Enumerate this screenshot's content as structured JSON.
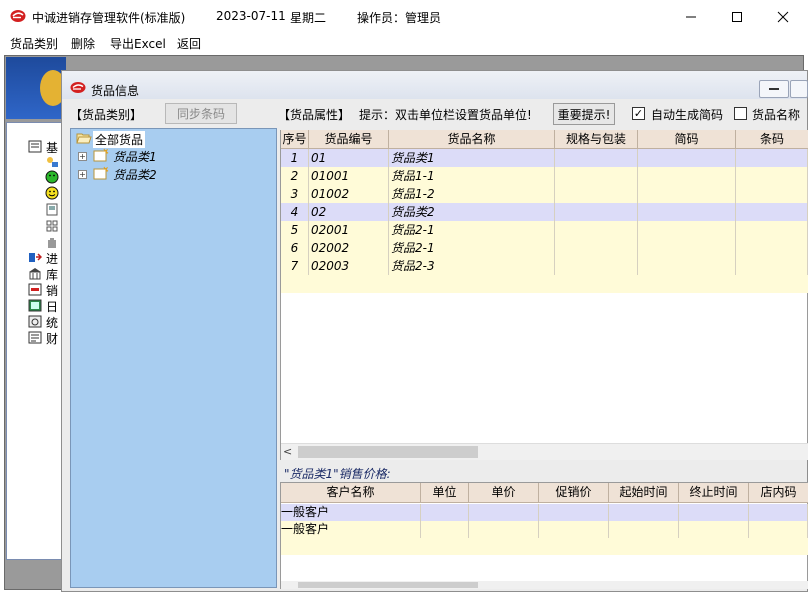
{
  "app": {
    "title": "中诚进销存管理软件(标准版)",
    "date": "2023-07-11",
    "weekday": "星期二",
    "operator": "操作员：管理员"
  },
  "menu": [
    "货品类别",
    "删除",
    "导出Excel",
    "返回"
  ],
  "background_window": {
    "items": [
      "基",
      "进",
      "库",
      "销",
      "日",
      "统",
      "财"
    ]
  },
  "child_window": {
    "title": "货品信息"
  },
  "toolbar": {
    "category_label": "【货品类别】",
    "sync_button": "同步条码",
    "attr_label": "【货品属性】",
    "hint": "提示：双击单位栏设置货品单位!",
    "important_button": "重要提示!",
    "auto_code_label": "自动生成简码",
    "auto_code_checked": true,
    "name_label": "货品名称",
    "name_checked": false
  },
  "tree": {
    "root": "全部货品",
    "children": [
      "货品类1",
      "货品类2"
    ]
  },
  "grid": {
    "columns": [
      "序号",
      "货品编号",
      "货品名称",
      "规格与包装",
      "简码",
      "条码"
    ],
    "rows": [
      {
        "no": "1",
        "code": "01",
        "name": "货品类1",
        "category": true
      },
      {
        "no": "2",
        "code": "01001",
        "name": "货品1-1",
        "category": false
      },
      {
        "no": "3",
        "code": "01002",
        "name": "货品1-2",
        "category": false
      },
      {
        "no": "4",
        "code": "02",
        "name": "货品类2",
        "category": true
      },
      {
        "no": "5",
        "code": "02001",
        "name": "货品2-1",
        "category": false
      },
      {
        "no": "6",
        "code": "02002",
        "name": "货品2-1",
        "category": false
      },
      {
        "no": "7",
        "code": "02003",
        "name": "货品2-3",
        "category": false
      }
    ]
  },
  "price": {
    "title": "\"货品类1\"销售价格:",
    "columns": [
      "客户名称",
      "单位",
      "单价",
      "促销价",
      "起始时间",
      "终止时间",
      "店内码"
    ],
    "rows": [
      "一般客户",
      "一般客户"
    ]
  },
  "colors": {
    "tree_bg": "#a8cdf0",
    "grid_header": "#efe2d6",
    "row_category": "#dcdcf8",
    "row_item": "#fffbd8"
  }
}
